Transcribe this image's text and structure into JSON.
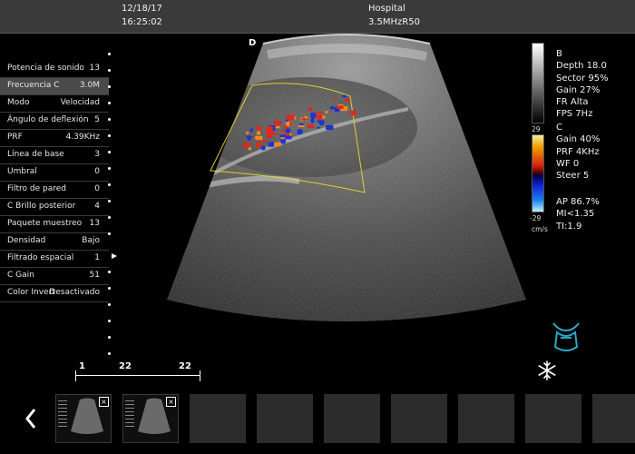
{
  "header": {
    "date": "12/18/17",
    "time": "16:25:02",
    "facility": "Hospital",
    "probe": "3.5MHzR50"
  },
  "orientation_marker": "D",
  "params": [
    {
      "label": "Potencia de sonido",
      "value": "13"
    },
    {
      "label": "Frecuencia C",
      "value": "3.0M",
      "selected": true
    },
    {
      "label": "Modo",
      "value": "Velocidad"
    },
    {
      "label": "Ángulo de deflexión",
      "value": "5"
    },
    {
      "label": "PRF",
      "value": "4.39KHz"
    },
    {
      "label": "Línea de base",
      "value": "3"
    },
    {
      "label": "Umbral",
      "value": "0"
    },
    {
      "label": "Filtro de pared",
      "value": "0"
    },
    {
      "label": "C Brillo posterior",
      "value": "4"
    },
    {
      "label": "Paquete muestreo",
      "value": "13"
    },
    {
      "label": "Densidad",
      "value": "Bajo"
    },
    {
      "label": "Filtrado espacial",
      "value": "1"
    },
    {
      "label": "C Gain",
      "value": "51"
    },
    {
      "label": "Color Invert",
      "value": "Desactivado"
    }
  ],
  "bmode_info": [
    "B",
    "Depth 18.0",
    "Sector 95%",
    "Gain 27%",
    "FR Alta",
    "FPS 7Hz"
  ],
  "color_info": [
    "C",
    "Gain  40%",
    "PRF 4KHz",
    "WF 0",
    "Steer 5"
  ],
  "safety_info": [
    "AP 86.7%",
    "MI<1.35",
    "TI:1.9"
  ],
  "color_scale": {
    "max": "29",
    "min": "-29",
    "unit": "cm/s"
  },
  "cine": {
    "start": "1",
    "current": "22",
    "end": "22"
  },
  "thumbnails_filled": 2,
  "thumbnails_empty": 7,
  "colors": {
    "doppler_red": "#e0281e",
    "doppler_blue": "#1e32d2",
    "roi_yellow": "#e0d22a",
    "body_mark": "#2aa8c8"
  },
  "icons": {
    "freeze": "snowflake-icon",
    "body_mark": "abdomen-probe-icon",
    "prev": "chevron-left-icon",
    "next": "chevron-right-icon"
  }
}
